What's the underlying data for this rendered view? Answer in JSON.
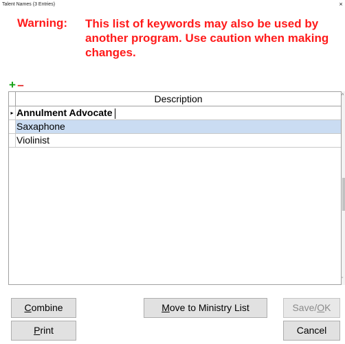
{
  "window": {
    "title": "Talent Names (3 Entries)",
    "close_symbol": "×"
  },
  "warning": {
    "label": "Warning:",
    "message": "This list of keywords may also be used by another program. Use caution when making changes."
  },
  "toolbar": {
    "add_symbol": "+",
    "remove_symbol": "–"
  },
  "grid": {
    "columns": [
      "Description"
    ],
    "rows": [
      {
        "description": "Annulment Advocate",
        "state": "editing"
      },
      {
        "description": "Saxaphone",
        "state": "selected"
      },
      {
        "description": "Violinist",
        "state": "normal"
      }
    ],
    "row_indicator": "▸"
  },
  "buttons": {
    "combine": {
      "mnemonic": "C",
      "rest": "ombine"
    },
    "print": {
      "mnemonic": "P",
      "rest": "rint"
    },
    "move": {
      "mnemonic": "M",
      "rest": "ove to Ministry List"
    },
    "save": {
      "prefix": "Save/",
      "mnemonic": "O",
      "rest": "K",
      "enabled": false
    },
    "cancel": {
      "label": "Cancel"
    }
  },
  "colors": {
    "warning": "#ff1a1a",
    "add": "#12a012",
    "remove": "#e01a1a",
    "selection": "#cadcf2"
  }
}
